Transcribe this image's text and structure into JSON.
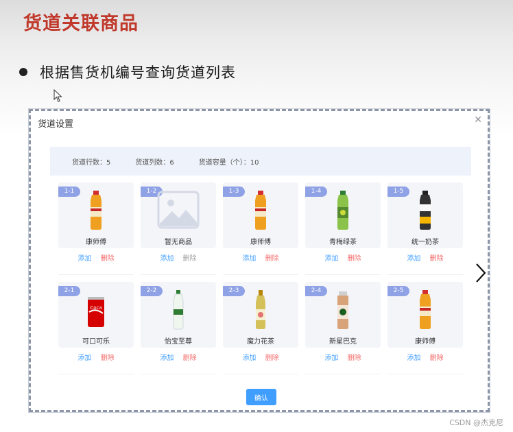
{
  "slide": {
    "title": "货道关联商品",
    "bullet": "根据售货机编号查询货道列表"
  },
  "dialog": {
    "title": "货道设置",
    "close_icon": "close-icon",
    "info": {
      "rows": "货道行数：5",
      "cols": "货道列数：6",
      "capacity": "货道容量（个）：10"
    },
    "confirm_label": "确认",
    "channels": [
      {
        "code": "1-1",
        "name": "康师傅",
        "image": "tea-bottle",
        "add": "添加",
        "del": "删除",
        "del_disabled": false
      },
      {
        "code": "1-2",
        "name": "暂无商品",
        "image": "placeholder",
        "add": "添加",
        "del": "删除",
        "del_disabled": true
      },
      {
        "code": "1-3",
        "name": "康师傅",
        "image": "tea-bottle",
        "add": "添加",
        "del": "删除",
        "del_disabled": false
      },
      {
        "code": "1-4",
        "name": "青梅绿茶",
        "image": "green-bottle",
        "add": "添加",
        "del": "删除",
        "del_disabled": false
      },
      {
        "code": "1-5",
        "name": "统一奶茶",
        "image": "dark-bottle",
        "add": "添加",
        "del": "删除",
        "del_disabled": false
      },
      {
        "code": "2-1",
        "name": "可口可乐",
        "image": "cola-can",
        "add": "添加",
        "del": "删除",
        "del_disabled": false
      },
      {
        "code": "2-2",
        "name": "怡宝至尊",
        "image": "water-bottle",
        "add": "添加",
        "del": "删除",
        "del_disabled": false
      },
      {
        "code": "2-3",
        "name": "魔力花茶",
        "image": "flower-bottle",
        "add": "添加",
        "del": "删除",
        "del_disabled": false
      },
      {
        "code": "2-4",
        "name": "新星巴克",
        "image": "coffee-bottle",
        "add": "添加",
        "del": "删除",
        "del_disabled": false
      },
      {
        "code": "2-5",
        "name": "康师傅",
        "image": "tea-bottle",
        "add": "添加",
        "del": "删除",
        "del_disabled": false
      }
    ]
  },
  "watermark": "CSDN @杰克尼",
  "colors": {
    "accent": "#409eff",
    "danger": "#f56c6c",
    "title": "#c0392b",
    "badge": "#8fa2e6"
  }
}
